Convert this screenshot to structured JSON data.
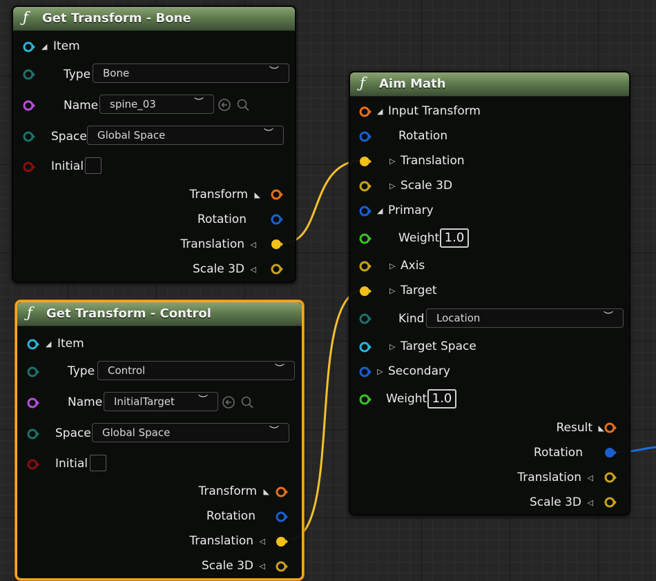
{
  "nodes": {
    "bone": {
      "title": "Get Transform - Bone",
      "item_label": "Item",
      "type_label": "Type",
      "type_value": "Bone",
      "name_label": "Name",
      "name_value": "spine_03",
      "space_label": "Space",
      "space_value": "Global Space",
      "initial_label": "Initial",
      "out_transform": "Transform",
      "out_rotation": "Rotation",
      "out_translation": "Translation",
      "out_scale": "Scale 3D"
    },
    "control": {
      "title": "Get Transform - Control",
      "item_label": "Item",
      "type_label": "Type",
      "type_value": "Control",
      "name_label": "Name",
      "name_value": "InitialTarget",
      "space_label": "Space",
      "space_value": "Global Space",
      "initial_label": "Initial",
      "out_transform": "Transform",
      "out_rotation": "Rotation",
      "out_translation": "Translation",
      "out_scale": "Scale 3D"
    },
    "aim": {
      "title": "Aim Math",
      "input_transform": "Input Transform",
      "rotation": "Rotation",
      "translation": "Translation",
      "scale": "Scale 3D",
      "primary": "Primary",
      "weight_label": "Weight",
      "weight_value": "1.0",
      "axis": "Axis",
      "target": "Target",
      "kind_label": "Kind",
      "kind_value": "Location",
      "target_space": "Target Space",
      "secondary": "Secondary",
      "weight2_label": "Weight",
      "weight2_value": "1.0",
      "out_result": "Result",
      "out_rotation": "Rotation",
      "out_translation": "Translation",
      "out_scale": "Scale 3D"
    }
  },
  "colors": {
    "pin_item": "#2bb3d6",
    "pin_name": "#b44fd6",
    "pin_space": "#1f7f7a",
    "pin_bool": "#8a0e0e",
    "pin_transform": "#e3701c",
    "pin_rotation": "#1b5fd1",
    "pin_vector": "#f2c01a",
    "pin_float": "#3fbf2a",
    "wire_vector": "#f5c12a",
    "wire_rotation": "#1e6fe0",
    "selection": "#f5a623"
  },
  "icons": [
    "function-icon",
    "arrow-left-circle-icon",
    "search-icon",
    "chevron-down-icon",
    "expand-triangle-icon"
  ]
}
